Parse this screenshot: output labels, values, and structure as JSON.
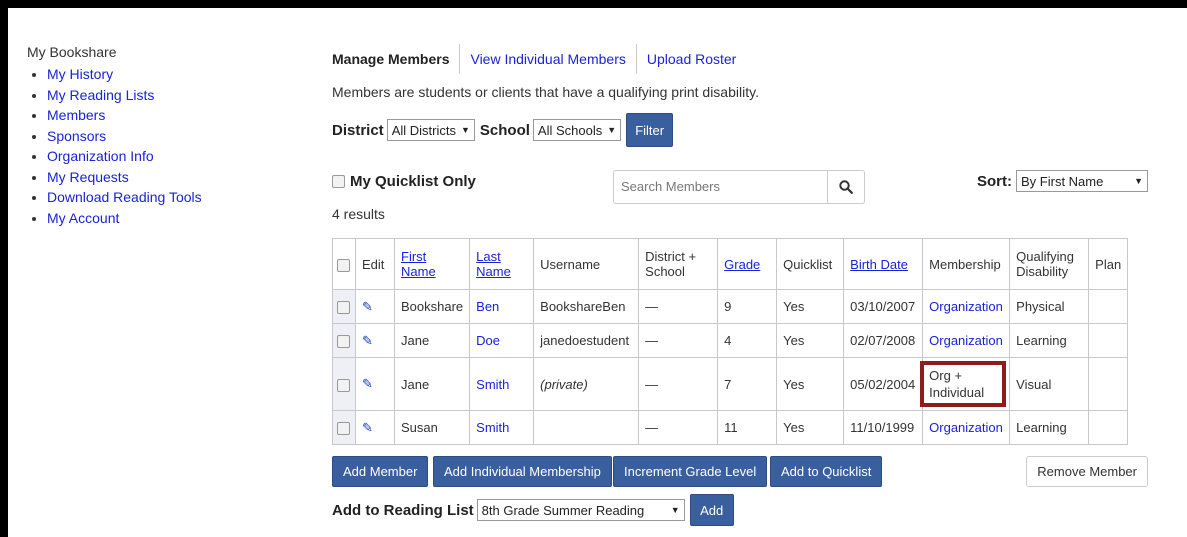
{
  "sidebar": {
    "title": "My Bookshare",
    "items": [
      {
        "label": "My History"
      },
      {
        "label": "My Reading Lists"
      },
      {
        "label": "Members"
      },
      {
        "label": "Sponsors"
      },
      {
        "label": "Organization Info"
      },
      {
        "label": "My Requests"
      },
      {
        "label": "Download Reading Tools"
      },
      {
        "label": "My Account"
      }
    ]
  },
  "tabs": [
    {
      "label": "Manage Members"
    },
    {
      "label": "View Individual Members"
    },
    {
      "label": "Upload Roster"
    }
  ],
  "description": "Members are students or clients that have a qualifying print disability.",
  "filters": {
    "district_label": "District",
    "district_value": "All Districts",
    "school_label": "School",
    "school_value": "All Schools",
    "filter_button": "Filter"
  },
  "quicklist": {
    "label": "My Quicklist Only"
  },
  "search": {
    "placeholder": "Search Members",
    "icon": "search-icon"
  },
  "sort": {
    "label": "Sort:",
    "value": "By First Name"
  },
  "results_count": "4 results",
  "table": {
    "headers": [
      "Edit",
      "First Name",
      "Last Name",
      "Username",
      "District + School",
      "Grade",
      "Quicklist",
      "Birth Date",
      "Membership",
      "Qualifying Disability",
      "Plan"
    ],
    "rows": [
      {
        "first": "Bookshare",
        "last": "Ben",
        "username": "BookshareBen",
        "district": "—",
        "grade": "9",
        "quicklist": "Yes",
        "birth": "03/10/2007",
        "membership": "Organization",
        "disability": "Physical",
        "plan": ""
      },
      {
        "first": "Jane",
        "last": "Doe",
        "username": "janedoestudent",
        "district": "—",
        "grade": "4",
        "quicklist": "Yes",
        "birth": "02/07/2008",
        "membership": "Organization",
        "disability": "Learning",
        "plan": ""
      },
      {
        "first": "Jane",
        "last": "Smith",
        "username": "(private)",
        "district": "—",
        "grade": "7",
        "quicklist": "Yes",
        "birth": "05/02/2004",
        "membership": "Org + Individual",
        "disability": "Visual",
        "plan": ""
      },
      {
        "first": "Susan",
        "last": "Smith",
        "username": "",
        "district": "—",
        "grade": "11",
        "quicklist": "Yes",
        "birth": "11/10/1999",
        "membership": "Organization",
        "disability": "Learning",
        "plan": ""
      }
    ]
  },
  "actions": {
    "add_member": "Add Member",
    "add_individual": "Add Individual Membership",
    "increment_grade": "Increment Grade Level",
    "add_quicklist": "Add to Quicklist",
    "remove_member": "Remove Member"
  },
  "reading_list": {
    "label": "Add to Reading List",
    "value": "8th Grade Summer Reading",
    "add_button": "Add"
  }
}
